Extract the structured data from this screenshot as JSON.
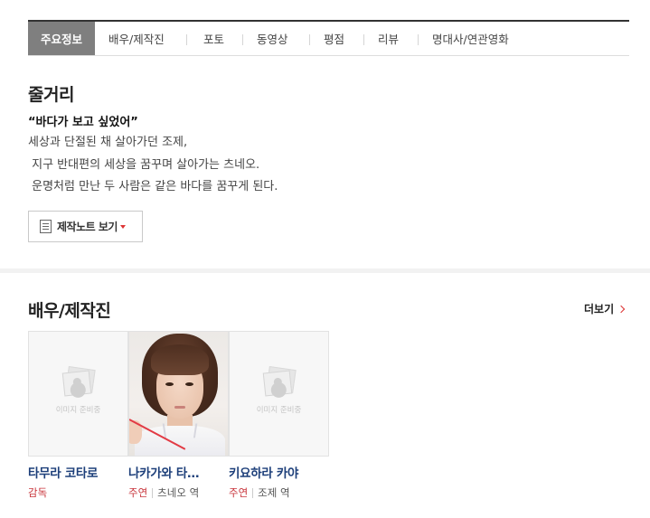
{
  "tabs": [
    {
      "label": "주요정보",
      "active": true
    },
    {
      "label": "배우/제작진"
    },
    {
      "label": "포토"
    },
    {
      "label": "동영상"
    },
    {
      "label": "평점"
    },
    {
      "label": "리뷰"
    },
    {
      "label": "명대사/연관영화"
    }
  ],
  "synopsis": {
    "title": "줄거리",
    "tagline": "“바다가 보고 싶었어”",
    "text": "세상과 단절된 채 살아가던 조제,\n 지구 반대편의 세상을 꿈꾸며 살아가는 츠네오.\n 운명처럼 만난 두 사람은 같은 바다를 꿈꾸게 된다.",
    "note_button": "제작노트 보기"
  },
  "cast": {
    "title": "배우/제작진",
    "more_label": "더보기",
    "placeholder_text": "이미지 준비중",
    "people": [
      {
        "name": "타무라 코타로",
        "role": "감독",
        "character": "",
        "has_photo": false
      },
      {
        "name": "나카가와 타…",
        "role": "주연",
        "character": "츠네오 역",
        "has_photo": true
      },
      {
        "name": "키요하라 카야",
        "role": "주연",
        "character": "조제 역",
        "has_photo": false
      }
    ]
  },
  "colors": {
    "accent_red": "#c8343b",
    "name_blue": "#1d3f7a",
    "active_tab_bg": "#7f7f7f"
  }
}
